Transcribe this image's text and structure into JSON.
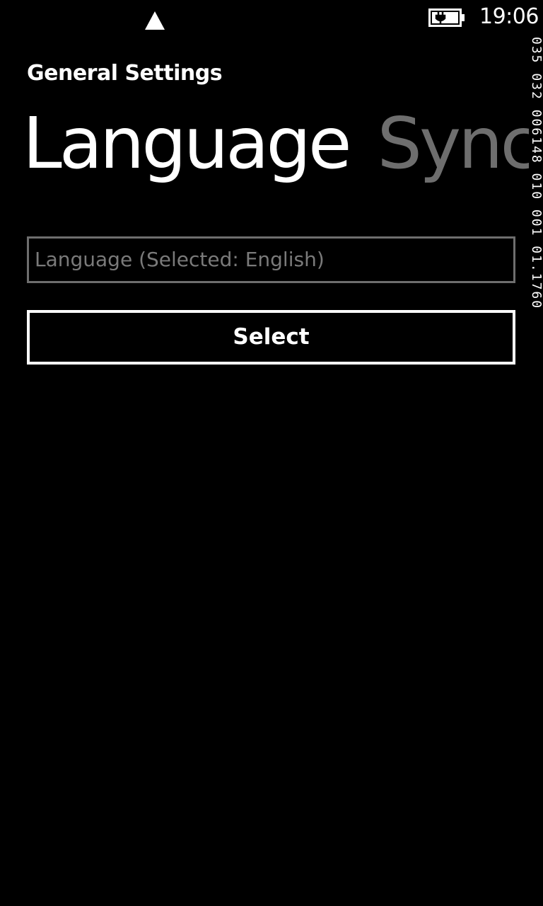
{
  "status_bar": {
    "time": "19:06",
    "signal_icon": "triangle-up-icon",
    "battery_icon": "battery-charging-icon"
  },
  "debug_counter": "035 032 006148 010 001 01.1760",
  "app": {
    "title": "General Settings"
  },
  "pivot": {
    "items": [
      {
        "label": "Language",
        "active": true
      },
      {
        "label": "Sync",
        "active": false
      }
    ]
  },
  "language_panel": {
    "field_text": "Language (Selected: English)",
    "select_label": "Select"
  },
  "colors": {
    "background": "#000000",
    "foreground": "#ffffff",
    "inactive": "#6e6e6e",
    "field_text": "#7a7a7a"
  }
}
